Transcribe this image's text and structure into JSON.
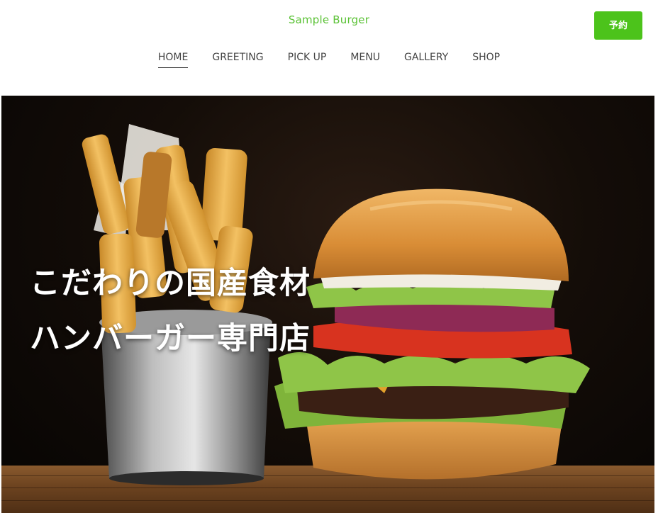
{
  "header": {
    "logo": "Sample Burger",
    "reserve_label": "予約"
  },
  "nav": {
    "items": [
      {
        "label": "HOME",
        "active": true
      },
      {
        "label": "GREETING",
        "active": false
      },
      {
        "label": "PICK UP",
        "active": false
      },
      {
        "label": "MENU",
        "active": false
      },
      {
        "label": "GALLERY",
        "active": false
      },
      {
        "label": "SHOP",
        "active": false
      }
    ]
  },
  "hero": {
    "line1": "こだわりの国産食材",
    "line2": "ハンバーガー専門店"
  },
  "colors": {
    "accent": "#4cc31b",
    "logo": "#5bc236",
    "nav_text": "#444444",
    "headline_text": "#ffffff"
  }
}
